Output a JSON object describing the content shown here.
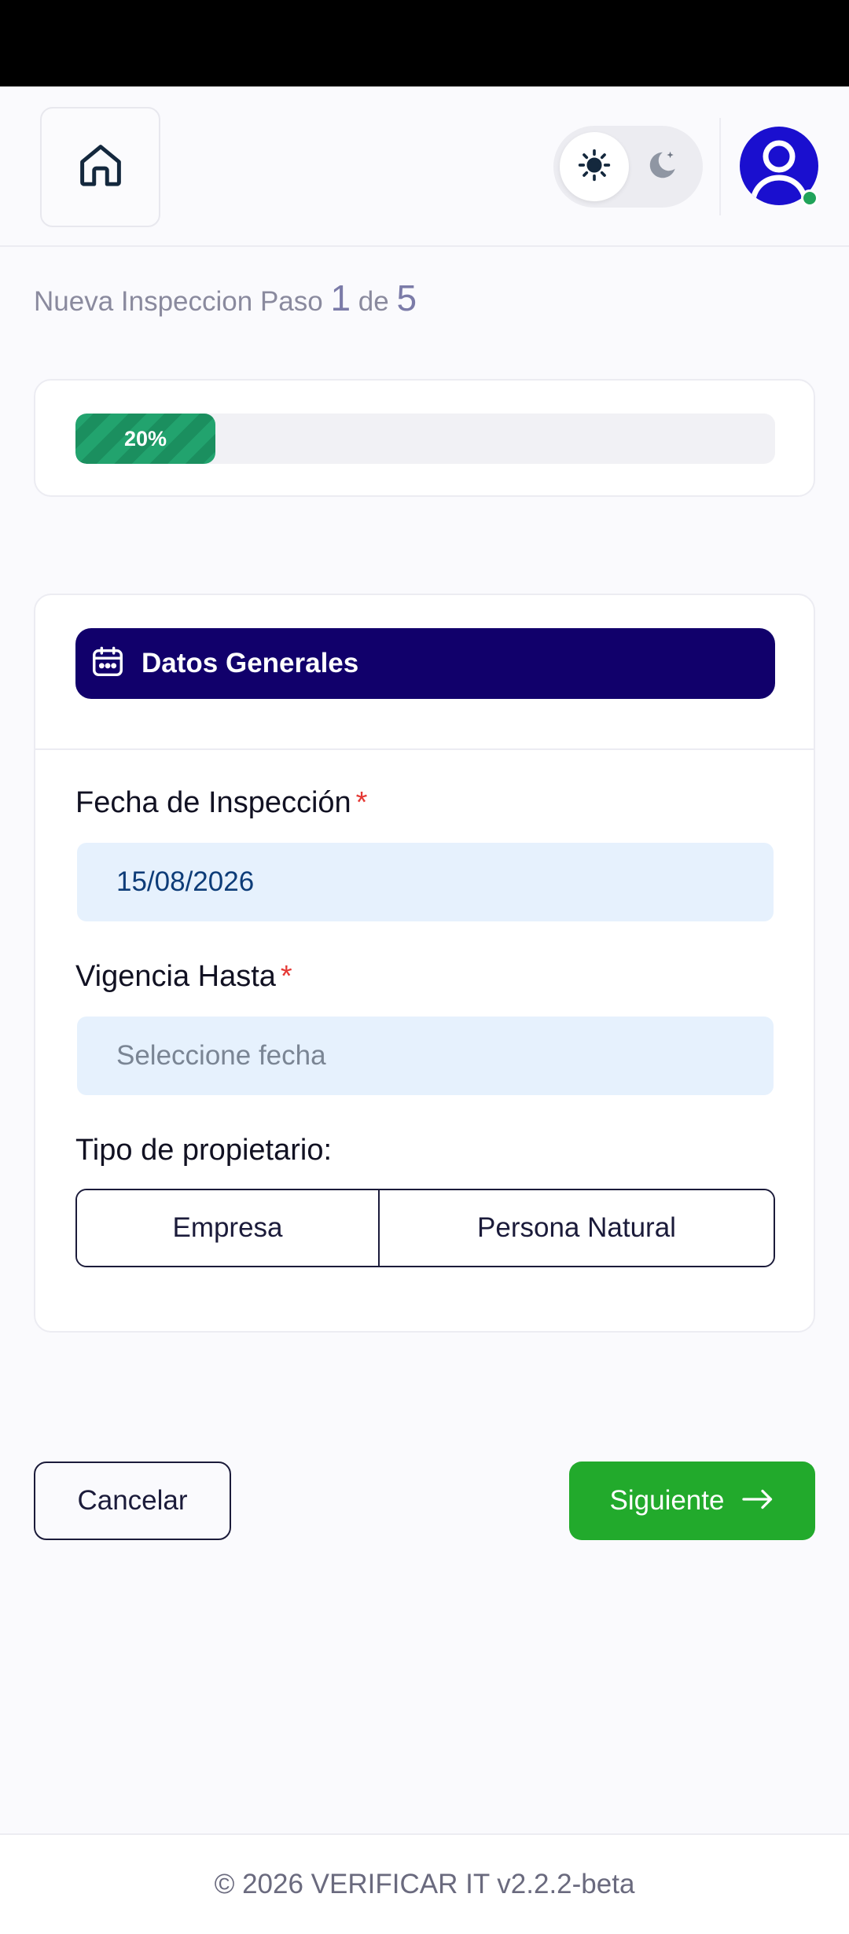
{
  "header": {
    "home_icon": "home-icon",
    "theme": {
      "light_icon": "sun-icon",
      "dark_icon": "moon-icon",
      "active": "light"
    },
    "avatar_icon": "user-icon",
    "status_color": "#20a35a"
  },
  "step": {
    "prefix": "Nueva Inspeccion Paso",
    "current": "1",
    "of_label": "de",
    "total": "5"
  },
  "progress": {
    "percent": 20,
    "label": "20%"
  },
  "section": {
    "icon": "calendar-icon",
    "title": "Datos Generales"
  },
  "form": {
    "fecha": {
      "label": "Fecha de Inspección",
      "required_mark": "*",
      "value": "15/08/2026"
    },
    "vigencia": {
      "label": "Vigencia Hasta",
      "required_mark": "*",
      "placeholder": "Seleccione fecha"
    },
    "tipo": {
      "label": "Tipo de propietario:",
      "options": [
        "Empresa",
        "Persona Natural"
      ]
    }
  },
  "actions": {
    "cancel": "Cancelar",
    "next": "Siguiente",
    "next_icon": "arrow-right-icon"
  },
  "footer": {
    "text": "© 2026 VERIFICAR IT v2.2.2-beta"
  },
  "colors": {
    "section_bg": "#11006b",
    "next_button": "#22aa2c",
    "progress_fill": "#22a36e",
    "input_bg": "#e6f1fd",
    "required": "#e53935"
  }
}
